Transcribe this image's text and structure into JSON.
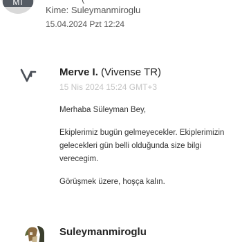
{
  "previous_message": {
    "avatar_text": "MI",
    "partial_header": "(",
    "to_label": "Kime: Suleymanmiroglu",
    "date": "15.04.2024 Pzt 12:24"
  },
  "message": {
    "sender_name": "Merve I.",
    "sender_org": "(Vivense TR)",
    "timestamp": "15 Nis 2024 15:24 GMT+3",
    "body": [
      "Merhaba Süleyman Bey,",
      "Ekiplerimiz bugün gelmeyecekler. Ekiplerimizin gelecekleri gün belli olduğunda size bilgi verecegim.",
      "Görüşmek üzere, hoşça kalın."
    ]
  },
  "next_message": {
    "sender_name": "Suleymanmiroglu"
  },
  "colors": {
    "vivense_icon": "#4a4f57",
    "timestamp": "#c4c4c4",
    "text": "#333333"
  },
  "icons": {
    "sender_avatar": "vivense-logo-icon",
    "next_avatar": "user-photo-icon"
  }
}
